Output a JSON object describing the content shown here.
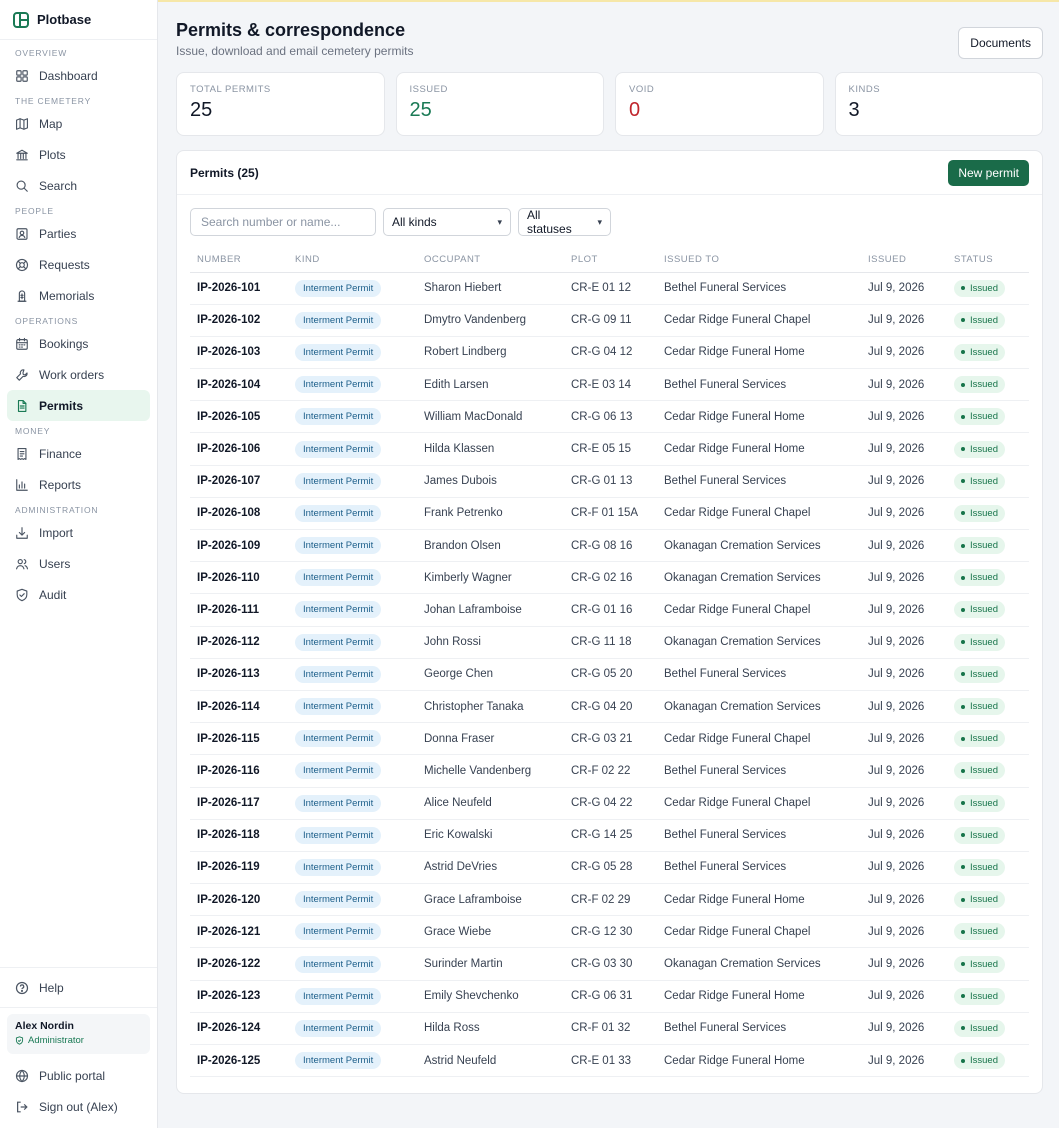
{
  "app": {
    "name": "Plotbase"
  },
  "sidebar": {
    "sections": [
      {
        "label": "OVERVIEW",
        "items": [
          {
            "label": "Dashboard",
            "icon": "grid-icon"
          }
        ]
      },
      {
        "label": "THE CEMETERY",
        "items": [
          {
            "label": "Map",
            "icon": "map-icon"
          },
          {
            "label": "Plots",
            "icon": "bank-icon"
          },
          {
            "label": "Search",
            "icon": "search-icon"
          }
        ]
      },
      {
        "label": "PEOPLE",
        "items": [
          {
            "label": "Parties",
            "icon": "contact-icon"
          },
          {
            "label": "Requests",
            "icon": "lifebuoy-icon"
          },
          {
            "label": "Memorials",
            "icon": "memorial-icon"
          }
        ]
      },
      {
        "label": "OPERATIONS",
        "items": [
          {
            "label": "Bookings",
            "icon": "calendar-icon"
          },
          {
            "label": "Work orders",
            "icon": "wrench-icon"
          },
          {
            "label": "Permits",
            "icon": "document-icon",
            "active": true
          }
        ]
      },
      {
        "label": "MONEY",
        "items": [
          {
            "label": "Finance",
            "icon": "receipt-icon"
          },
          {
            "label": "Reports",
            "icon": "bar-chart-icon"
          }
        ]
      },
      {
        "label": "ADMINISTRATION",
        "items": [
          {
            "label": "Import",
            "icon": "import-icon"
          },
          {
            "label": "Users",
            "icon": "users-icon"
          },
          {
            "label": "Audit",
            "icon": "shield-icon"
          }
        ]
      }
    ],
    "help": "Help",
    "user": {
      "name": "Alex Nordin",
      "role": "Administrator"
    },
    "public_portal": "Public portal",
    "sign_out": "Sign out (Alex)"
  },
  "header": {
    "title": "Permits & correspondence",
    "subtitle": "Issue, download and email cemetery permits",
    "documents_button": "Documents"
  },
  "stats": [
    {
      "label": "TOTAL PERMITS",
      "value": "25",
      "tone": "default"
    },
    {
      "label": "ISSUED",
      "value": "25",
      "tone": "green"
    },
    {
      "label": "VOID",
      "value": "0",
      "tone": "red"
    },
    {
      "label": "KINDS",
      "value": "3",
      "tone": "default"
    }
  ],
  "permits": {
    "title": "Permits (25)",
    "new_button": "New permit",
    "search_placeholder": "Search number or name...",
    "kind_filter": "All kinds",
    "status_filter": "All statuses",
    "columns": [
      "NUMBER",
      "KIND",
      "OCCUPANT",
      "PLOT",
      "ISSUED TO",
      "ISSUED",
      "STATUS"
    ],
    "rows": [
      [
        "IP-2026-101",
        "Interment Permit",
        "Sharon Hiebert",
        "CR-E 01 12",
        "Bethel Funeral Services",
        "Jul 9, 2026",
        "Issued"
      ],
      [
        "IP-2026-102",
        "Interment Permit",
        "Dmytro Vandenberg",
        "CR-G 09 11",
        "Cedar Ridge Funeral Chapel",
        "Jul 9, 2026",
        "Issued"
      ],
      [
        "IP-2026-103",
        "Interment Permit",
        "Robert Lindberg",
        "CR-G 04 12",
        "Cedar Ridge Funeral Home",
        "Jul 9, 2026",
        "Issued"
      ],
      [
        "IP-2026-104",
        "Interment Permit",
        "Edith Larsen",
        "CR-E 03 14",
        "Bethel Funeral Services",
        "Jul 9, 2026",
        "Issued"
      ],
      [
        "IP-2026-105",
        "Interment Permit",
        "William MacDonald",
        "CR-G 06 13",
        "Cedar Ridge Funeral Home",
        "Jul 9, 2026",
        "Issued"
      ],
      [
        "IP-2026-106",
        "Interment Permit",
        "Hilda Klassen",
        "CR-E 05 15",
        "Cedar Ridge Funeral Home",
        "Jul 9, 2026",
        "Issued"
      ],
      [
        "IP-2026-107",
        "Interment Permit",
        "James Dubois",
        "CR-G 01 13",
        "Bethel Funeral Services",
        "Jul 9, 2026",
        "Issued"
      ],
      [
        "IP-2026-108",
        "Interment Permit",
        "Frank Petrenko",
        "CR-F 01 15A",
        "Cedar Ridge Funeral Chapel",
        "Jul 9, 2026",
        "Issued"
      ],
      [
        "IP-2026-109",
        "Interment Permit",
        "Brandon Olsen",
        "CR-G 08 16",
        "Okanagan Cremation Services",
        "Jul 9, 2026",
        "Issued"
      ],
      [
        "IP-2026-110",
        "Interment Permit",
        "Kimberly Wagner",
        "CR-G 02 16",
        "Okanagan Cremation Services",
        "Jul 9, 2026",
        "Issued"
      ],
      [
        "IP-2026-111",
        "Interment Permit",
        "Johan Laframboise",
        "CR-G 01 16",
        "Cedar Ridge Funeral Chapel",
        "Jul 9, 2026",
        "Issued"
      ],
      [
        "IP-2026-112",
        "Interment Permit",
        "John Rossi",
        "CR-G 11 18",
        "Okanagan Cremation Services",
        "Jul 9, 2026",
        "Issued"
      ],
      [
        "IP-2026-113",
        "Interment Permit",
        "George Chen",
        "CR-G 05 20",
        "Bethel Funeral Services",
        "Jul 9, 2026",
        "Issued"
      ],
      [
        "IP-2026-114",
        "Interment Permit",
        "Christopher Tanaka",
        "CR-G 04 20",
        "Okanagan Cremation Services",
        "Jul 9, 2026",
        "Issued"
      ],
      [
        "IP-2026-115",
        "Interment Permit",
        "Donna Fraser",
        "CR-G 03 21",
        "Cedar Ridge Funeral Chapel",
        "Jul 9, 2026",
        "Issued"
      ],
      [
        "IP-2026-116",
        "Interment Permit",
        "Michelle Vandenberg",
        "CR-F 02 22",
        "Bethel Funeral Services",
        "Jul 9, 2026",
        "Issued"
      ],
      [
        "IP-2026-117",
        "Interment Permit",
        "Alice Neufeld",
        "CR-G 04 22",
        "Cedar Ridge Funeral Chapel",
        "Jul 9, 2026",
        "Issued"
      ],
      [
        "IP-2026-118",
        "Interment Permit",
        "Eric Kowalski",
        "CR-G 14 25",
        "Bethel Funeral Services",
        "Jul 9, 2026",
        "Issued"
      ],
      [
        "IP-2026-119",
        "Interment Permit",
        "Astrid DeVries",
        "CR-G 05 28",
        "Bethel Funeral Services",
        "Jul 9, 2026",
        "Issued"
      ],
      [
        "IP-2026-120",
        "Interment Permit",
        "Grace Laframboise",
        "CR-F 02 29",
        "Cedar Ridge Funeral Home",
        "Jul 9, 2026",
        "Issued"
      ],
      [
        "IP-2026-121",
        "Interment Permit",
        "Grace Wiebe",
        "CR-G 12 30",
        "Cedar Ridge Funeral Chapel",
        "Jul 9, 2026",
        "Issued"
      ],
      [
        "IP-2026-122",
        "Interment Permit",
        "Surinder Martin",
        "CR-G 03 30",
        "Okanagan Cremation Services",
        "Jul 9, 2026",
        "Issued"
      ],
      [
        "IP-2026-123",
        "Interment Permit",
        "Emily Shevchenko",
        "CR-G 06 31",
        "Cedar Ridge Funeral Home",
        "Jul 9, 2026",
        "Issued"
      ],
      [
        "IP-2026-124",
        "Interment Permit",
        "Hilda Ross",
        "CR-F 01 32",
        "Bethel Funeral Services",
        "Jul 9, 2026",
        "Issued"
      ],
      [
        "IP-2026-125",
        "Interment Permit",
        "Astrid Neufeld",
        "CR-E 01 33",
        "Cedar Ridge Funeral Home",
        "Jul 9, 2026",
        "Issued"
      ]
    ]
  },
  "colors": {
    "accent": "#1a6b49",
    "issued": "#17744a",
    "void": "#c0262d",
    "kind_badge": "#1d5f8a"
  }
}
